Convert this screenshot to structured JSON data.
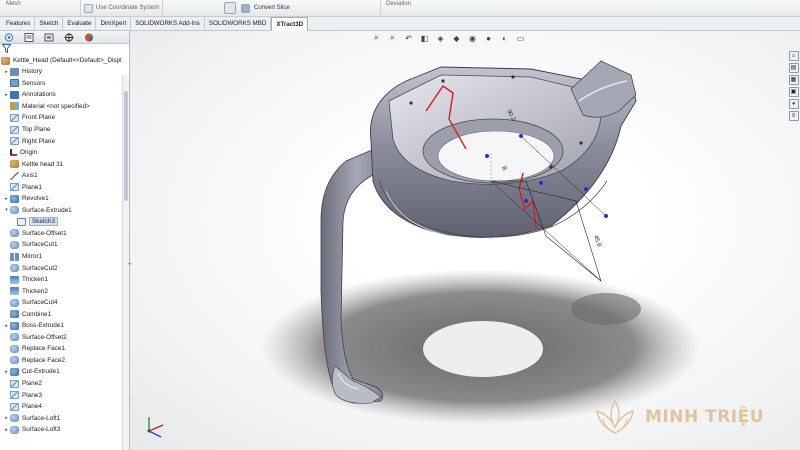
{
  "ribbon": {
    "items": [
      "Mesh",
      "Use Coordinate System",
      "Convert Slice",
      "Deviation"
    ]
  },
  "command_tabs": [
    {
      "label": "Features",
      "active": false
    },
    {
      "label": "Sketch",
      "active": false
    },
    {
      "label": "Evaluate",
      "active": false
    },
    {
      "label": "DimXpert",
      "active": false
    },
    {
      "label": "SOLIDWORKS Add-Ins",
      "active": false
    },
    {
      "label": "SOLIDWORKS MBD",
      "active": false
    },
    {
      "label": "XTract3D",
      "active": true
    }
  ],
  "feature_tree": {
    "panel_tabs": [
      "feature-manager-icon",
      "property-manager-icon",
      "configuration-manager-icon",
      "dimxpert-icon",
      "display-manager-icon"
    ],
    "root": "Kettle_Head  (Default<<Default>_Displ",
    "items": [
      {
        "label": "History",
        "icon": "folder-icon",
        "expand": true
      },
      {
        "label": "Sensors",
        "icon": "sensor-icon",
        "expand": false
      },
      {
        "label": "Annotations",
        "icon": "annotations-icon",
        "expand": true
      },
      {
        "label": "Material <not specified>",
        "icon": "material-icon",
        "expand": false
      },
      {
        "label": "Front Plane",
        "icon": "plane-icon",
        "expand": false
      },
      {
        "label": "Top Plane",
        "icon": "plane-icon",
        "expand": false
      },
      {
        "label": "Right Plane",
        "icon": "plane-icon",
        "expand": false
      },
      {
        "label": "Origin",
        "icon": "origin-icon",
        "expand": false
      },
      {
        "label": "Kettle head 31",
        "icon": "part-icon",
        "expand": false
      },
      {
        "label": "Axis1",
        "icon": "axis-icon",
        "expand": false
      },
      {
        "label": "Plane1",
        "icon": "plane-icon",
        "expand": false
      },
      {
        "label": "Revolve1",
        "icon": "feature-icon",
        "expand": true
      },
      {
        "label": "Surface-Extrude1",
        "icon": "surface-icon",
        "expand": true,
        "open": true
      },
      {
        "label": "Sketch3",
        "icon": "sketch-icon",
        "expand": false,
        "child": true,
        "selected": true
      },
      {
        "label": "Surface-Offset1",
        "icon": "surface-icon",
        "expand": false
      },
      {
        "label": "SurfaceCut1",
        "icon": "surface-icon",
        "expand": false
      },
      {
        "label": "Mirror1",
        "icon": "mirror-icon",
        "expand": false
      },
      {
        "label": "SurfaceCut2",
        "icon": "surface-icon",
        "expand": false
      },
      {
        "label": "Thicken1",
        "icon": "thicken-icon",
        "expand": false
      },
      {
        "label": "Thicken2",
        "icon": "thicken-icon",
        "expand": false
      },
      {
        "label": "SurfaceCut4",
        "icon": "surface-icon",
        "expand": false
      },
      {
        "label": "Combine1",
        "icon": "feature-icon",
        "expand": false
      },
      {
        "label": "Boss-Extrude1",
        "icon": "feature-icon",
        "expand": true
      },
      {
        "label": "Surface-Offset2",
        "icon": "surface-icon",
        "expand": false
      },
      {
        "label": "Replace Face1",
        "icon": "surface-icon",
        "expand": false
      },
      {
        "label": "Replace Face2",
        "icon": "surface-icon",
        "expand": false
      },
      {
        "label": "Cut-Extrude1",
        "icon": "feature-icon",
        "expand": true
      },
      {
        "label": "Plane2",
        "icon": "plane-icon",
        "expand": false
      },
      {
        "label": "Plane3",
        "icon": "plane-icon",
        "expand": false
      },
      {
        "label": "Plane4",
        "icon": "plane-icon",
        "expand": false
      },
      {
        "label": "Surface-Loft1",
        "icon": "surface-icon",
        "expand": true
      },
      {
        "label": "Surface-Loft3",
        "icon": "surface-icon",
        "expand": true
      }
    ]
  },
  "viewport": {
    "heads_up_icons": [
      "zoom-to-fit-icon",
      "zoom-area-icon",
      "previous-view-icon",
      "section-view-icon",
      "view-orientation-icon",
      "display-style-icon",
      "hide-show-icon",
      "edit-appearance-icon",
      "apply-scene-icon",
      "view-settings-icon"
    ],
    "task_pane_icons": [
      "resources-icon",
      "design-library-icon",
      "file-explorer-icon",
      "view-palette-icon",
      "appearances-icon",
      "custom-properties-icon"
    ]
  },
  "watermark": {
    "text": "MINH TRIỆU"
  },
  "colors": {
    "part_body": "#8c8e9e",
    "sketch_red": "#d81e1e",
    "point_blue": "#2233cc",
    "watermark": "#e3c49a"
  }
}
